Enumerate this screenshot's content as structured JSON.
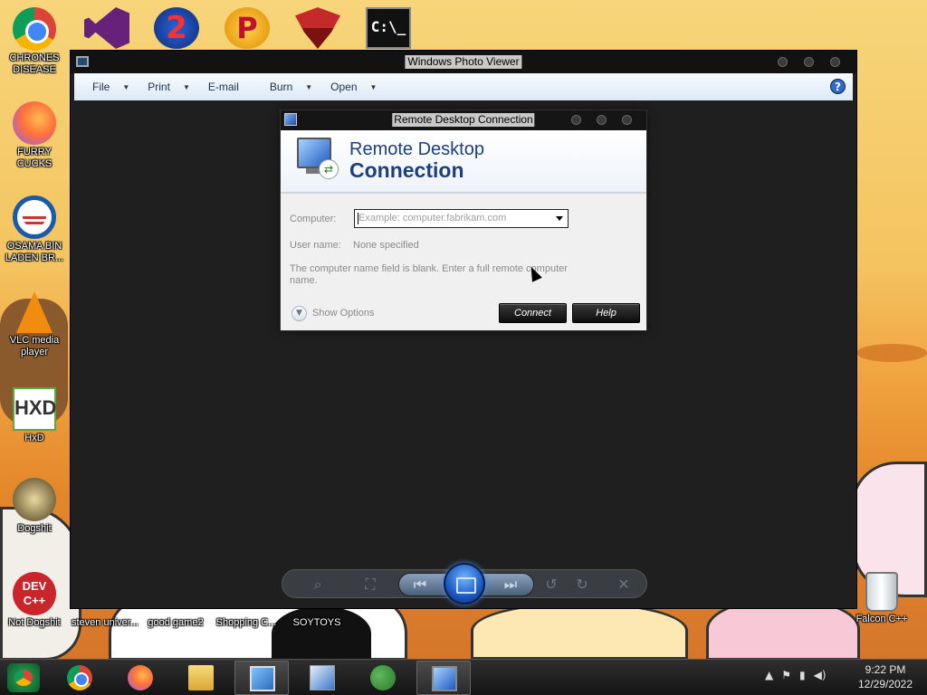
{
  "desktop": {
    "left_icons": [
      {
        "label": "CHRONES DISEASE",
        "icon": "chrome-icon"
      },
      {
        "label": "FURRY CUCKS",
        "icon": "firefox-icon"
      },
      {
        "label": "OSAMA BIN LADEN BR...",
        "icon": "obama-logo-icon"
      },
      {
        "label": "VLC media player",
        "icon": "vlc-icon"
      },
      {
        "label": "HxD",
        "icon": "hxd-icon"
      },
      {
        "label": "Dogshit",
        "icon": "dogshit-icon"
      },
      {
        "label": "Not Dogshit",
        "icon": "devcpp-icon"
      }
    ],
    "dev_badge": "DEV\nC++",
    "hxd_glyph": "HXD",
    "bottom_labels": [
      "steven univer...",
      "good game2",
      "Shopping C...",
      "SOYTOYS"
    ],
    "recycle_label": "Falcon C++",
    "top_icons": [
      "visual-studio-icon",
      "number-two-icon",
      "p-badge-icon",
      "eagle-emblem-icon",
      "command-prompt-icon"
    ],
    "top_glyphs": {
      "two": "2",
      "p": "P",
      "cmd": "C:\\_"
    }
  },
  "photo_viewer": {
    "title": "Windows Photo Viewer",
    "menu": [
      {
        "label": "File",
        "has_dropdown": true
      },
      {
        "label": "Print",
        "has_dropdown": true
      },
      {
        "label": "E-mail",
        "has_dropdown": false
      },
      {
        "label": "Burn",
        "has_dropdown": true
      },
      {
        "label": "Open",
        "has_dropdown": true
      }
    ],
    "help_glyph": "?"
  },
  "rdp": {
    "title": "Remote Desktop Connection",
    "heading_line1": "Remote Desktop",
    "heading_line2": "Connection",
    "computer_label": "Computer:",
    "computer_placeholder": "Example: computer.fabrikam.com",
    "username_label": "User name:",
    "username_value": "None specified",
    "message": "The computer name field is blank.  Enter a full remote computer name.",
    "show_options": "Show Options",
    "connect": "Connect",
    "help": "Help"
  },
  "taskbar": {
    "time": "9:22 PM",
    "date": "12/29/2022",
    "tray_icons": [
      "show-hidden-icon",
      "flag-icon",
      "network-icon",
      "volume-icon"
    ]
  }
}
